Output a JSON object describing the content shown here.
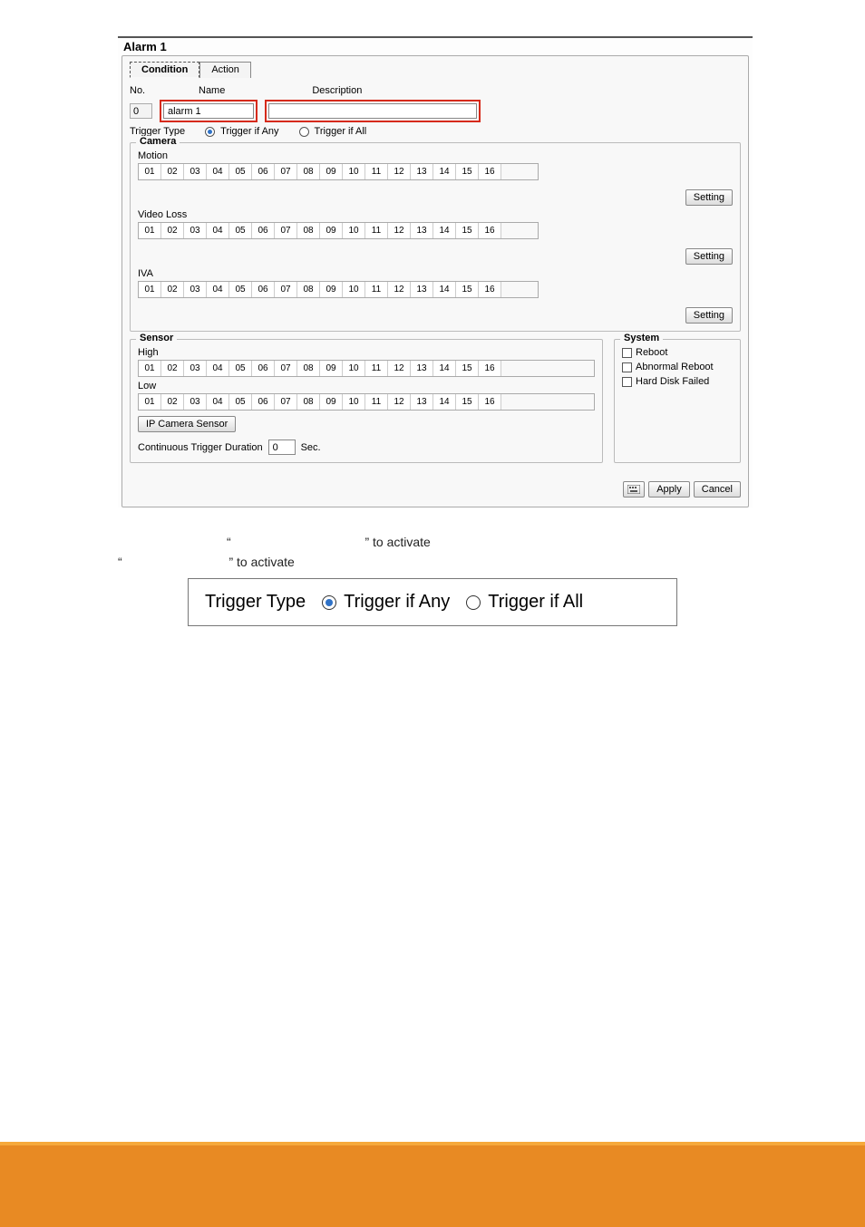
{
  "dialog": {
    "title": "Alarm 1",
    "tabs": {
      "condition": "Condition",
      "action": "Action"
    },
    "fields": {
      "no_label": "No.",
      "no_value": "0",
      "name_label": "Name",
      "name_value": "alarm 1",
      "desc_label": "Description",
      "desc_value": ""
    },
    "trigger": {
      "label": "Trigger Type",
      "any": "Trigger if Any",
      "all": "Trigger if All"
    },
    "camera": {
      "legend": "Camera",
      "motion": "Motion",
      "videoloss": "Video Loss",
      "iva": "IVA",
      "setting": "Setting",
      "channels": [
        "01",
        "02",
        "03",
        "04",
        "05",
        "06",
        "07",
        "08",
        "09",
        "10",
        "11",
        "12",
        "13",
        "14",
        "15",
        "16"
      ]
    },
    "sensor": {
      "legend": "Sensor",
      "high": "High",
      "low": "Low",
      "ip_btn": "IP Camera Sensor",
      "duration_label": "Continuous Trigger Duration",
      "duration_value": "0",
      "duration_unit": "Sec.",
      "channels": [
        "01",
        "02",
        "03",
        "04",
        "05",
        "06",
        "07",
        "08",
        "09",
        "10",
        "11",
        "12",
        "13",
        "14",
        "15",
        "16"
      ]
    },
    "system": {
      "legend": "System",
      "reboot": "Reboot",
      "abnormal": "Abnormal Reboot",
      "hdd": "Hard Disk Failed"
    },
    "buttons": {
      "apply": "Apply",
      "cancel": "Cancel"
    }
  },
  "body_text": {
    "line1a": "“",
    "line1b": "” to activate",
    "line2a": "“",
    "line2b": "” to activate"
  },
  "trigger_fig": {
    "label": "Trigger Type",
    "any": "Trigger if Any",
    "all": "Trigger if All"
  }
}
